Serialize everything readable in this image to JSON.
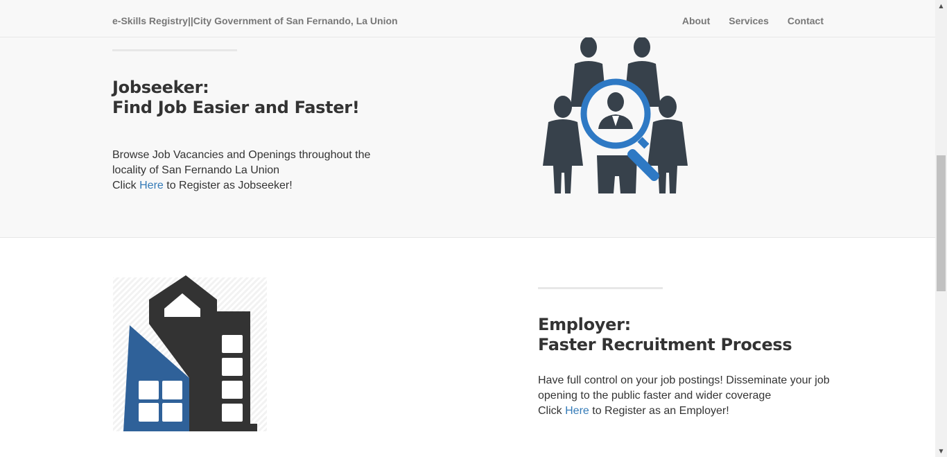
{
  "navbar": {
    "brand": "e-Skills Registry||City Government of San Fernando, La Union",
    "links": [
      "About",
      "Services",
      "Contact"
    ]
  },
  "jobseeker": {
    "heading_line1": "Jobseeker:",
    "heading_line2": "Find Job Easier and Faster!",
    "text_line1": "Browse Job Vacancies and Openings throughout the",
    "text_line2": "locality of San Fernando La Union",
    "click_prefix": "Click ",
    "link_text": "Here",
    "click_suffix": " to Register as Jobseeker!",
    "image_icon": "people-search-icon"
  },
  "employer": {
    "heading_line1": "Employer:",
    "heading_line2": "Faster Recruitment Process",
    "text_line1": "Have full control on your job postings! Disseminate your job",
    "text_line2": "opening to the public faster and wider coverage",
    "click_prefix": "Click ",
    "link_text": "Here",
    "click_suffix": " to Register as an Employer!",
    "image_icon": "buildings-icon"
  },
  "colors": {
    "accent_blue": "#337ab7",
    "icon_dark": "#37414b",
    "icon_blue": "#2e79c4",
    "building_dark": "#333333",
    "building_blue": "#2f6199"
  }
}
